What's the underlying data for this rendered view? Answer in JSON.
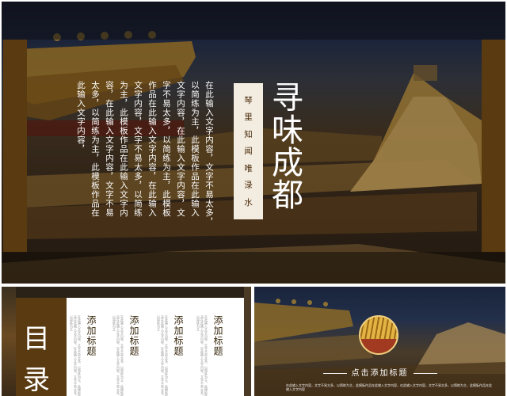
{
  "main_slide": {
    "title": "寻味成都",
    "subtitle_chars": [
      "琴",
      "里",
      "知",
      "闻",
      "唯",
      "渌",
      "水"
    ],
    "body_columns": [
      "在此输入文字内容，文字不易太多，",
      "以简练为主，此模板作品在此输入",
      "文字内容，在此输入文字内容，文",
      "字不易太多，以简练为主，此模板",
      "作品在此输入文字内容，在此输入",
      "文字内容，文字不易太多，以简练",
      "为主，此模板作品在此输入文字内",
      "容，在此输入文字内容，文字不易",
      "太多，以简练为主，此模板作品在",
      "此输入文字内容，"
    ]
  },
  "toc_slide": {
    "label": "目录",
    "items": [
      {
        "heading": "添加标题",
        "description": "在此输入文字内容，文字不易太多，以简练为主，此模板作品在此输入文字内容，在此输入文字内容，文字不易太多，以简练为主"
      },
      {
        "heading": "添加标题",
        "description": "在此输入文字内容，文字不易太多，以简练为主，此模板作品在此输入文字内容，在此输入文字内容，文字不易太多，以简练为主"
      },
      {
        "heading": "添加标题",
        "description": "在此输入文字内容，文字不易太多，以简练为主，此模板作品在此输入文字内容，在此输入文字内容，文字不易太多，以简练为主"
      },
      {
        "heading": "添加标题",
        "description": "在此输入文字内容，文字不易太多，以简练为主，此模板作品在此输入文字内容，在此输入文字内容，文字不易太多，以简练为主"
      }
    ]
  },
  "picture_slide": {
    "cta": "点击添加标题",
    "fine_print": "在此输入文字内容，文字不易太多，以简练为主，此模板作品在此输入文字内容，在此输入文字内容，文字不易太多，以简练为主，此模板作品在此输入文字内容"
  },
  "colors": {
    "accent_brown": "#5a3a10",
    "title_white": "#ffffff",
    "subtitle_box": "#f3ece0"
  }
}
